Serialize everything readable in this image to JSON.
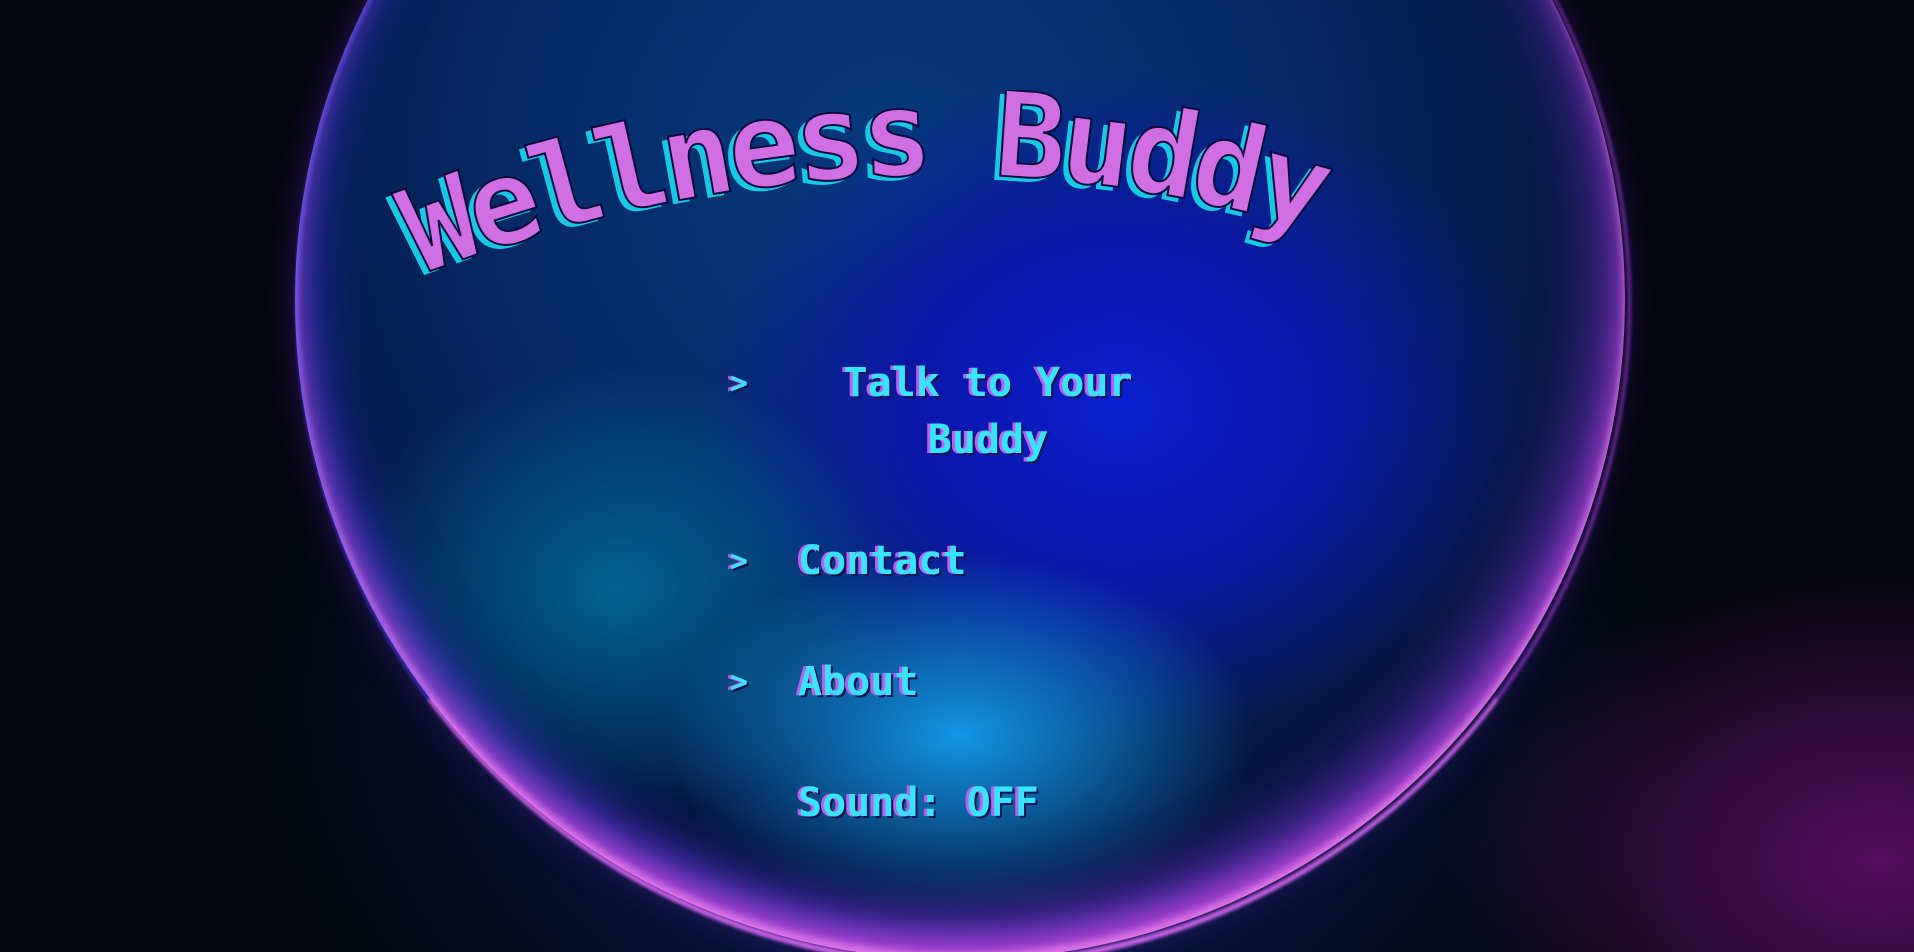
{
  "app": {
    "title": "Wellness Buddy"
  },
  "menu": {
    "items": [
      {
        "arrow": ">",
        "label": "Talk to Your Buddy"
      },
      {
        "arrow": ">",
        "label": "Contact"
      },
      {
        "arrow": ">",
        "label": "About"
      }
    ],
    "sound": {
      "label": "Sound: OFF"
    }
  },
  "colors": {
    "title": "#d06ee3",
    "title_shadow": "#18c9e6",
    "menu_text": "#36e4ff",
    "menu_shadow": "#c35cf0"
  }
}
